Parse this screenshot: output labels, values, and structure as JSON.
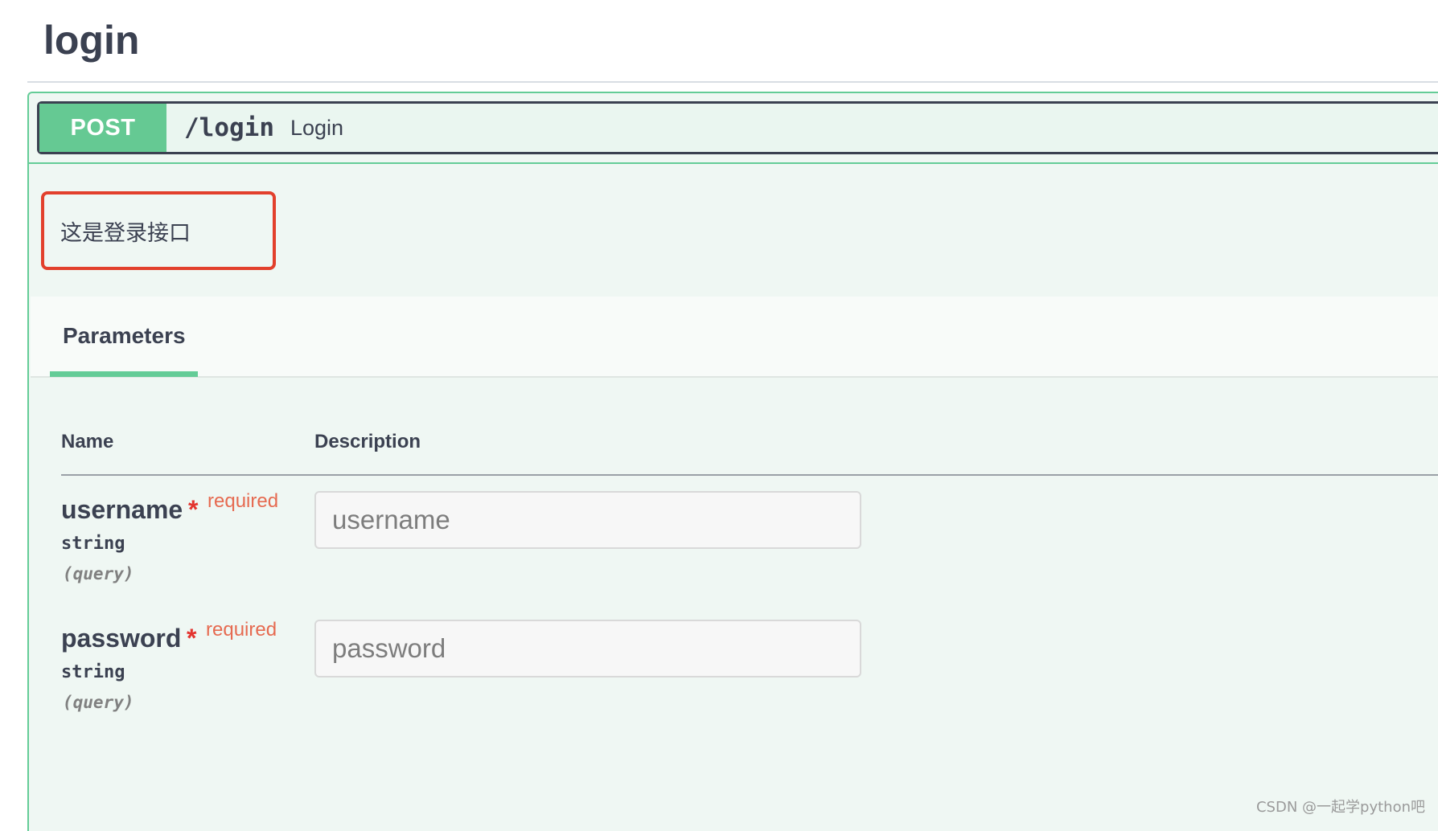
{
  "page": {
    "title": "login"
  },
  "operation": {
    "method": "POST",
    "path": "/login",
    "summary": "Login",
    "description": "这是登录接口",
    "method_color": "#65c993",
    "border_color": "#64cc97"
  },
  "tabs": {
    "parameters_label": "Parameters"
  },
  "table": {
    "columns": [
      "Name",
      "Description"
    ],
    "params": [
      {
        "name": "username",
        "star": "*",
        "required": "required",
        "type": "string",
        "in": "(query)",
        "placeholder": "username"
      },
      {
        "name": "password",
        "star": "*",
        "required": "required",
        "type": "string",
        "in": "(query)",
        "placeholder": "password"
      }
    ]
  },
  "watermark": "CSDN @一起学python吧"
}
